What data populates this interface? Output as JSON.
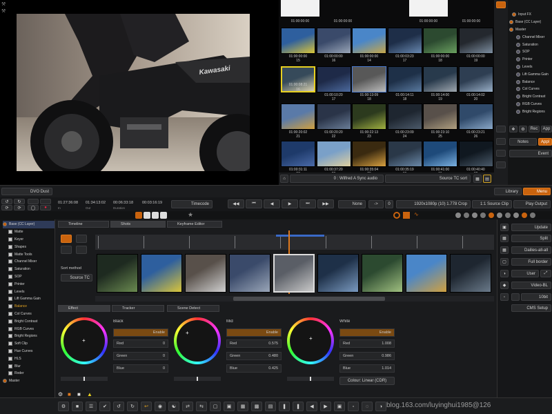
{
  "top_left_icons": [
    "wrench-icon",
    "wrench-icon"
  ],
  "browser": {
    "top_row_tcs": [
      "01:00:00:00",
      "01:00:00:00",
      "01:00:00:00",
      "01:00:00:00"
    ],
    "rows": [
      [
        {
          "tc": "01:00:00:00",
          "n": "15"
        },
        {
          "tc": "01:00:00:00",
          "n": "16"
        },
        {
          "tc": "01:00:00:00",
          "n": "14"
        },
        {
          "tc": "01:00:03:23",
          "n": "17"
        },
        {
          "tc": "01:00:00:00",
          "n": "18"
        },
        {
          "tc": "01:00:00:00",
          "n": "19"
        }
      ],
      [
        {
          "tc": "01:00:08:21",
          "n": "16"
        },
        {
          "tc": "01:00:10:20",
          "n": "17"
        },
        {
          "tc": "01:00:13:09",
          "n": "18"
        },
        {
          "tc": "01:00:14:11",
          "n": "18"
        },
        {
          "tc": "01:00:14:00",
          "n": "19"
        },
        {
          "tc": "01:00:14:02",
          "n": "20"
        }
      ],
      [
        {
          "tc": "01:00:20:02",
          "n": "21"
        },
        {
          "tc": "01:00:20:20",
          "n": "22"
        },
        {
          "tc": "01:00:22:13",
          "n": "23"
        },
        {
          "tc": "01:00:23:09",
          "n": "24"
        },
        {
          "tc": "01:00:23:10",
          "n": "25"
        },
        {
          "tc": "01:00:23:21",
          "n": "26"
        }
      ],
      [
        {
          "tc": "01:00:31:11",
          "n": "27"
        },
        {
          "tc": "01:00:37:20",
          "n": "28"
        },
        {
          "tc": "01:00:35:04",
          "n": "29"
        },
        {
          "tc": "01:00:35:19",
          "n": "30"
        },
        {
          "tc": "01:00:41:00",
          "n": "31"
        },
        {
          "tc": "01:00:40:40",
          "n": "32"
        }
      ]
    ],
    "bottom_left_label": "0 : Wilfred A Sync audio",
    "bottom_right_label": "Source TC sort"
  },
  "fx_tree": {
    "items": [
      "Input FX",
      "Base (CC Layer)",
      "Master",
      "Channel Mixer",
      "Saturation",
      "SOP",
      "Printer",
      "Levels",
      "Lift Gamma Gain",
      "Balance",
      "Col Curves",
      "Bright Contrast",
      "RGB Curves",
      "Bright Regions"
    ],
    "buttons": {
      "rec": "Rec",
      "app": "App",
      "notes": "Notes",
      "apply": "Appl",
      "event": "Event"
    }
  },
  "dvo_label": "DVO Dust",
  "transport": {
    "tc1": "01:27:36:08",
    "tc2": "01:34:13:02",
    "tc3": "00:06:33:18",
    "tc4": "00:03:16:19",
    "tc_labels": [
      "In",
      "Out",
      "Duration"
    ],
    "timecode_btn": "Timecode",
    "none_btn": "None",
    "arrow_val": "->",
    "zero_val": "0",
    "format": "1920x1080p (10) 1.778 Crop",
    "source_clip": "1:1 Source Clip",
    "play_output": "Play Output",
    "library": "Library",
    "menu": "Menu"
  },
  "left_tree": [
    "Base (CC Layer)",
    "Matte",
    "Keyer",
    "Shapes",
    "Matte Tools",
    "Channel Mixer",
    "Saturation",
    "SOP",
    "Printer",
    "Levels",
    "Lift Gamma Gain",
    "Balance",
    "Col Curves",
    "Bright Contrast",
    "RGB Curves",
    "Bright Regions",
    "Soft Clip",
    "Hue Curves",
    "HLS",
    "Blur",
    "Roder",
    "Master"
  ],
  "tabs": {
    "timeline": "Timeline",
    "shots": "Shots",
    "keyframe": "Keyframe Editor",
    "effect": "Effect",
    "tracker": "Tracker",
    "scene_detect": "Scene Detect"
  },
  "sort": {
    "label": "Sort method",
    "value": "Source TC"
  },
  "grading": {
    "black": {
      "title": "Black",
      "enable": "Enable",
      "red": "0",
      "green": "0",
      "blue": "0"
    },
    "mid": {
      "title": "Mid",
      "enable": "Enable",
      "red": "0.575",
      "green": "0.480",
      "blue": "0.425"
    },
    "white": {
      "title": "White",
      "enable": "Enable",
      "red": "1.008",
      "green": "0.986",
      "blue": "1.014"
    },
    "labels": {
      "red": "Red",
      "green": "Green",
      "blue": "Blue"
    },
    "colour_btn": "Colour: Linear (CDR)"
  },
  "right_panel": {
    "update": "Update",
    "split": "Split",
    "dailies": "Dailies-all-all",
    "full_border": "Full border",
    "user": "User",
    "video": "Video-BL",
    "val": "10bit",
    "cms": "CMS Setup"
  },
  "viewer_text": "Kawasaki",
  "watermark": "blog.163.com/luyinghui1985@126"
}
